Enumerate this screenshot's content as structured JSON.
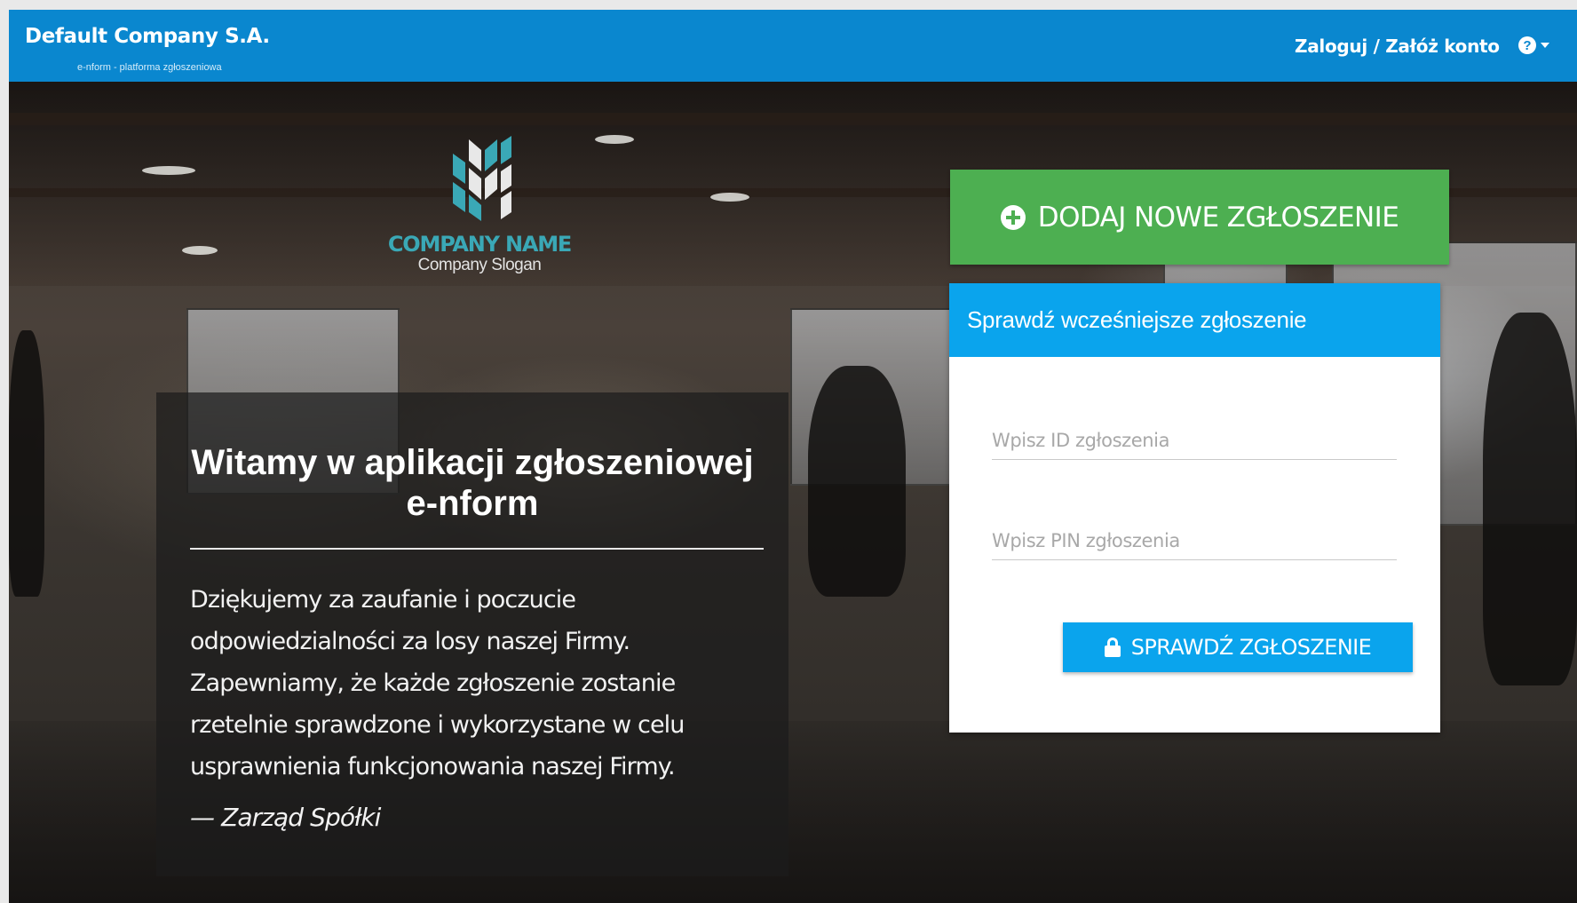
{
  "navbar": {
    "brand_name": "Default Company S.A.",
    "brand_subtitle": "e-nform - platforma zgłoszeniowa",
    "login_link": "Zaloguj / Załóż konto",
    "help_icon": "question-circle-icon",
    "help_glyph": "?"
  },
  "logo": {
    "company_name": "COMPANY NAME",
    "slogan": "Company Slogan"
  },
  "welcome": {
    "title_line1": "Witamy w aplikacji zgłoszeniowej",
    "title_line2": "e-nform",
    "text": "Dziękujemy za zaufanie i poczucie odpowiedzialności za losy naszej Firmy. Zapewniamy, że każde zgłoszenie zostanie rzetelnie sprawdzone i wykorzystane w celu usprawnienia funkcjonowania naszej Firmy.",
    "signature": "— Zarząd Spółki"
  },
  "actions": {
    "new_report_label": "DODAJ NOWE ZGŁOSZENIE",
    "new_report_icon": "plus-circle-icon"
  },
  "check": {
    "header": "Sprawdź wcześniejsze zgłoszenie",
    "id_placeholder": "Wpisz ID zgłoszenia",
    "pin_placeholder": "Wpisz PIN zgłoszenia",
    "button_label": "SPRAWDŹ ZGŁOSZENIE",
    "button_icon": "lock-icon"
  },
  "colors": {
    "navbar": "#0a87cf",
    "new_report_button": "#4daf51",
    "check_accent": "#0aa4ed",
    "logo_teal": "#3aa8b6"
  }
}
